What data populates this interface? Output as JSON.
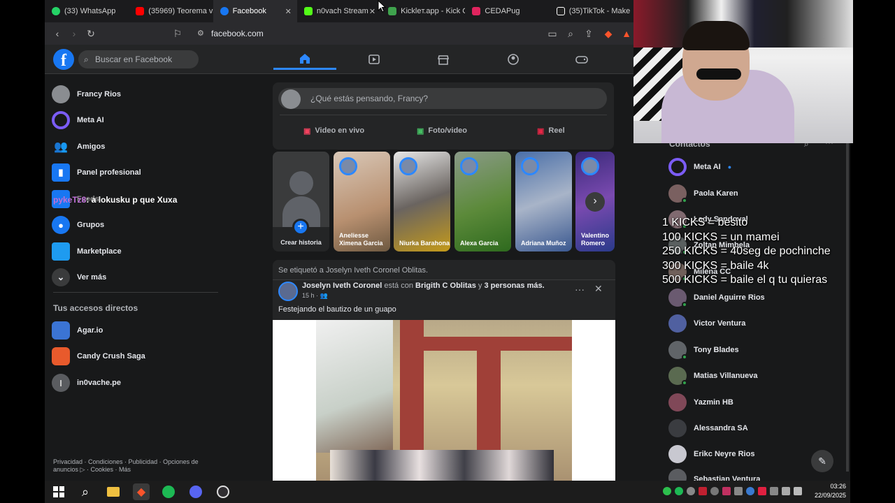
{
  "browser": {
    "tabs": [
      {
        "title": "(33) WhatsApp",
        "color": "#25d366"
      },
      {
        "title": "(35969) Teorema vs",
        "color": "#ff0000"
      },
      {
        "title": "Facebook",
        "color": "#1877f2"
      },
      {
        "title": "n0vach Stream",
        "color": "#53fc18"
      },
      {
        "title": "Kickleт.app - Kick C",
        "color": "#3fa34d"
      },
      {
        "title": "CEDAPug",
        "color": "#e0245e"
      },
      {
        "title": "(35)TikTok - Make",
        "color": "#ffffff"
      }
    ],
    "url": "facebook.com"
  },
  "facebook": {
    "search_placeholder": "Buscar en Facebook",
    "sidebar": [
      {
        "label": "Francy Rios",
        "icon": "avatar"
      },
      {
        "label": "Meta AI",
        "icon": "meta-ai-icon"
      },
      {
        "label": "Amigos",
        "icon": "friends-icon"
      },
      {
        "label": "Panel profesional",
        "icon": "dashboard-icon"
      },
      {
        "label": "Feeds",
        "icon": "feeds-icon"
      },
      {
        "label": "Grupos",
        "icon": "groups-icon"
      },
      {
        "label": "Marketplace",
        "icon": "marketplace-icon"
      },
      {
        "label": "Ver más",
        "icon": "chevron-down-icon"
      }
    ],
    "shortcuts_title": "Tus accesos directos",
    "shortcuts": [
      {
        "label": "Agar.io"
      },
      {
        "label": "Candy Crush Saga"
      },
      {
        "label": "in0vache.pe"
      }
    ],
    "footer": "Privacidad · Condiciones · Publicidad · Opciones de anuncios ▷ · Cookies · Más",
    "composer": {
      "placeholder": "¿Qué estás pensando, Francy?",
      "buttons": [
        "Video en vivo",
        "Foto/video",
        "Reel"
      ]
    },
    "stories": [
      "Crear historia",
      "Aneliesse Ximena Garcia",
      "Niurka Barahona",
      "Alexa Garcia",
      "Adriana Muñoz",
      "Valentino Romero"
    ],
    "post": {
      "tagged": "Se etiquetó a Joselyn Iveth Coronel Oblitas.",
      "author": "Joselyn Iveth Coronel",
      "with_text": "está con",
      "with_person": "Brigith C Oblitas",
      "and_text": "y",
      "others": "3 personas más.",
      "time": "15 h ·",
      "text": "Festejando el bautizo de un guapo"
    },
    "contacts_title": "Contactos",
    "contacts": [
      "Meta AI",
      "Paola Karen",
      "Lady Sandoval",
      "Zoltan Mimbela",
      "Milena CC",
      "Daniel Aguirre Rios",
      "Victor Ventura",
      "Tony Blades",
      "Matias Villanueva",
      "Yazmin HB",
      "Alessandra SA",
      "Erikc Neyre Rios",
      "Sebastian Ventura"
    ]
  },
  "stream": {
    "chat_user": "pykeTz8",
    "chat_message": ": a lokusku p que Xuxa",
    "kicks": [
      "1 KICKS = besito",
      "100 KICKS = un mamei",
      "250 KICKS = 40seg de pochinche",
      "300 KICKS = baile 4k",
      "500 KICKS = baile el q tu quieras"
    ]
  },
  "taskbar": {
    "time": "03:26",
    "date": "22/09/2025"
  }
}
